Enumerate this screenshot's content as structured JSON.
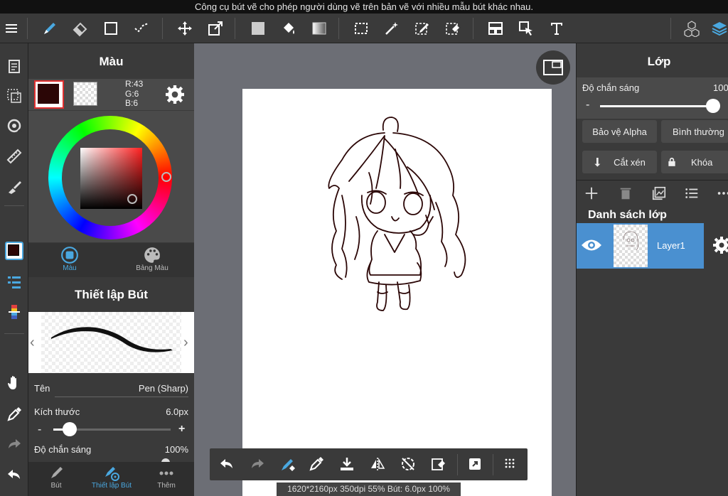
{
  "status_bar": {
    "text": "Công cụ bút vẽ cho phép người dùng vẽ trên bản vẽ với nhiều mẫu bút khác nhau."
  },
  "color_panel": {
    "title": "Màu",
    "rgb": {
      "r": "R:43",
      "g": "G:6",
      "b": "B:6"
    },
    "current_color": "#2b0606",
    "tabs": [
      {
        "label": "Màu"
      },
      {
        "label": "Bảng Màu"
      }
    ]
  },
  "brush_panel": {
    "title": "Thiết lập Bút",
    "name_label": "Tên",
    "name_value": "Pen (Sharp)",
    "size_label": "Kích thước",
    "size_value": "6.0px",
    "size_minus": "-",
    "size_plus": "+",
    "size_fraction": 0.14,
    "opacity_label": "Độ chắn sáng",
    "opacity_value": "100%"
  },
  "bottom_tabs": [
    {
      "label": "Bút"
    },
    {
      "label": "Thiết lập Bút"
    },
    {
      "label": "Thêm"
    }
  ],
  "canvas_info": "1620*2160px 350dpi 55% Bút: 6.0px 100%",
  "layer_panel": {
    "title": "Lớp",
    "opacity_label": "Độ chắn sáng",
    "opacity_value": "100",
    "opacity_minus": "-",
    "opacity_fraction": 0.98,
    "alpha_protect": "Bảo vệ Alpha",
    "blend_mode": "Bình thường",
    "clipping": "Cắt xén",
    "lock": "Khóa",
    "list_title": "Danh sách lớp",
    "layers": [
      {
        "name": "Layer1"
      }
    ]
  },
  "colors": {
    "accent": "#4a90d0",
    "tab_active": "#4aa8e0"
  }
}
